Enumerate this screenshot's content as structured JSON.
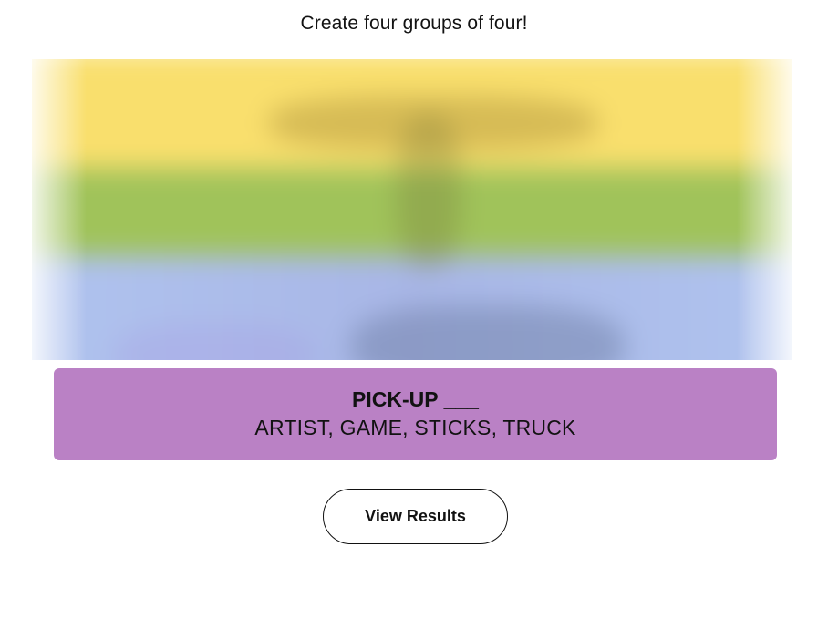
{
  "game": {
    "instructions": "Create four groups of four!"
  },
  "board": {
    "state": "blurred",
    "band_colors": [
      "#f9df6d",
      "#a0c35a",
      "#b0c4ef"
    ]
  },
  "solved_groups": [
    {
      "category": "PICK-UP ___",
      "members": "ARTIST, GAME, STICKS, TRUCK",
      "color": "#ba81c5"
    }
  ],
  "actions": {
    "view_results_label": "View Results"
  }
}
